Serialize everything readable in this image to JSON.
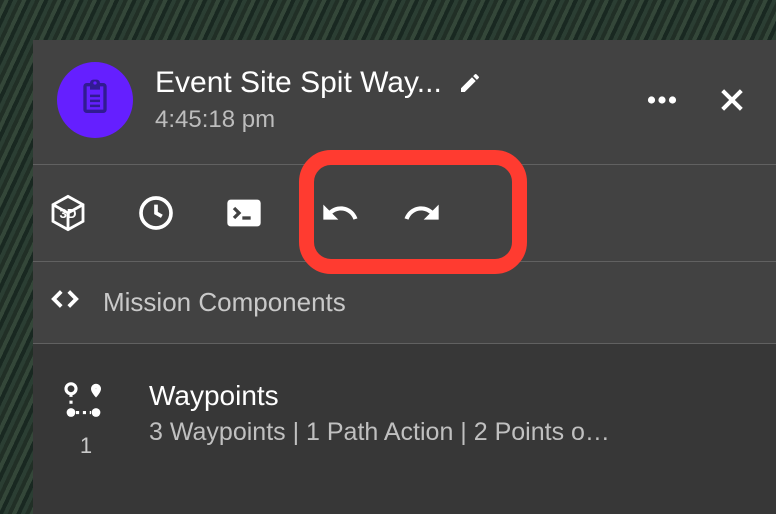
{
  "header": {
    "title": "Event Site Spit Way...",
    "subtitle": "4:45:18 pm"
  },
  "section": {
    "label": "Mission Components"
  },
  "waypoints": {
    "title": "Waypoints",
    "summary": "3 Waypoints | 1 Path Action | 2 Points o…",
    "count": "1"
  },
  "icons": {
    "avatar": "clipboard-icon",
    "edit": "pencil-icon",
    "more": "more-horiz-icon",
    "close": "close-icon",
    "three_d": "3d-box-icon",
    "clock": "clock-icon",
    "terminal": "terminal-icon",
    "undo": "undo-icon",
    "redo": "redo-icon",
    "expand": "chevrons-icon",
    "waypoints": "route-icon"
  },
  "colors": {
    "accent": "#651fff",
    "highlight": "#ff3b30",
    "panel": "#424242"
  }
}
